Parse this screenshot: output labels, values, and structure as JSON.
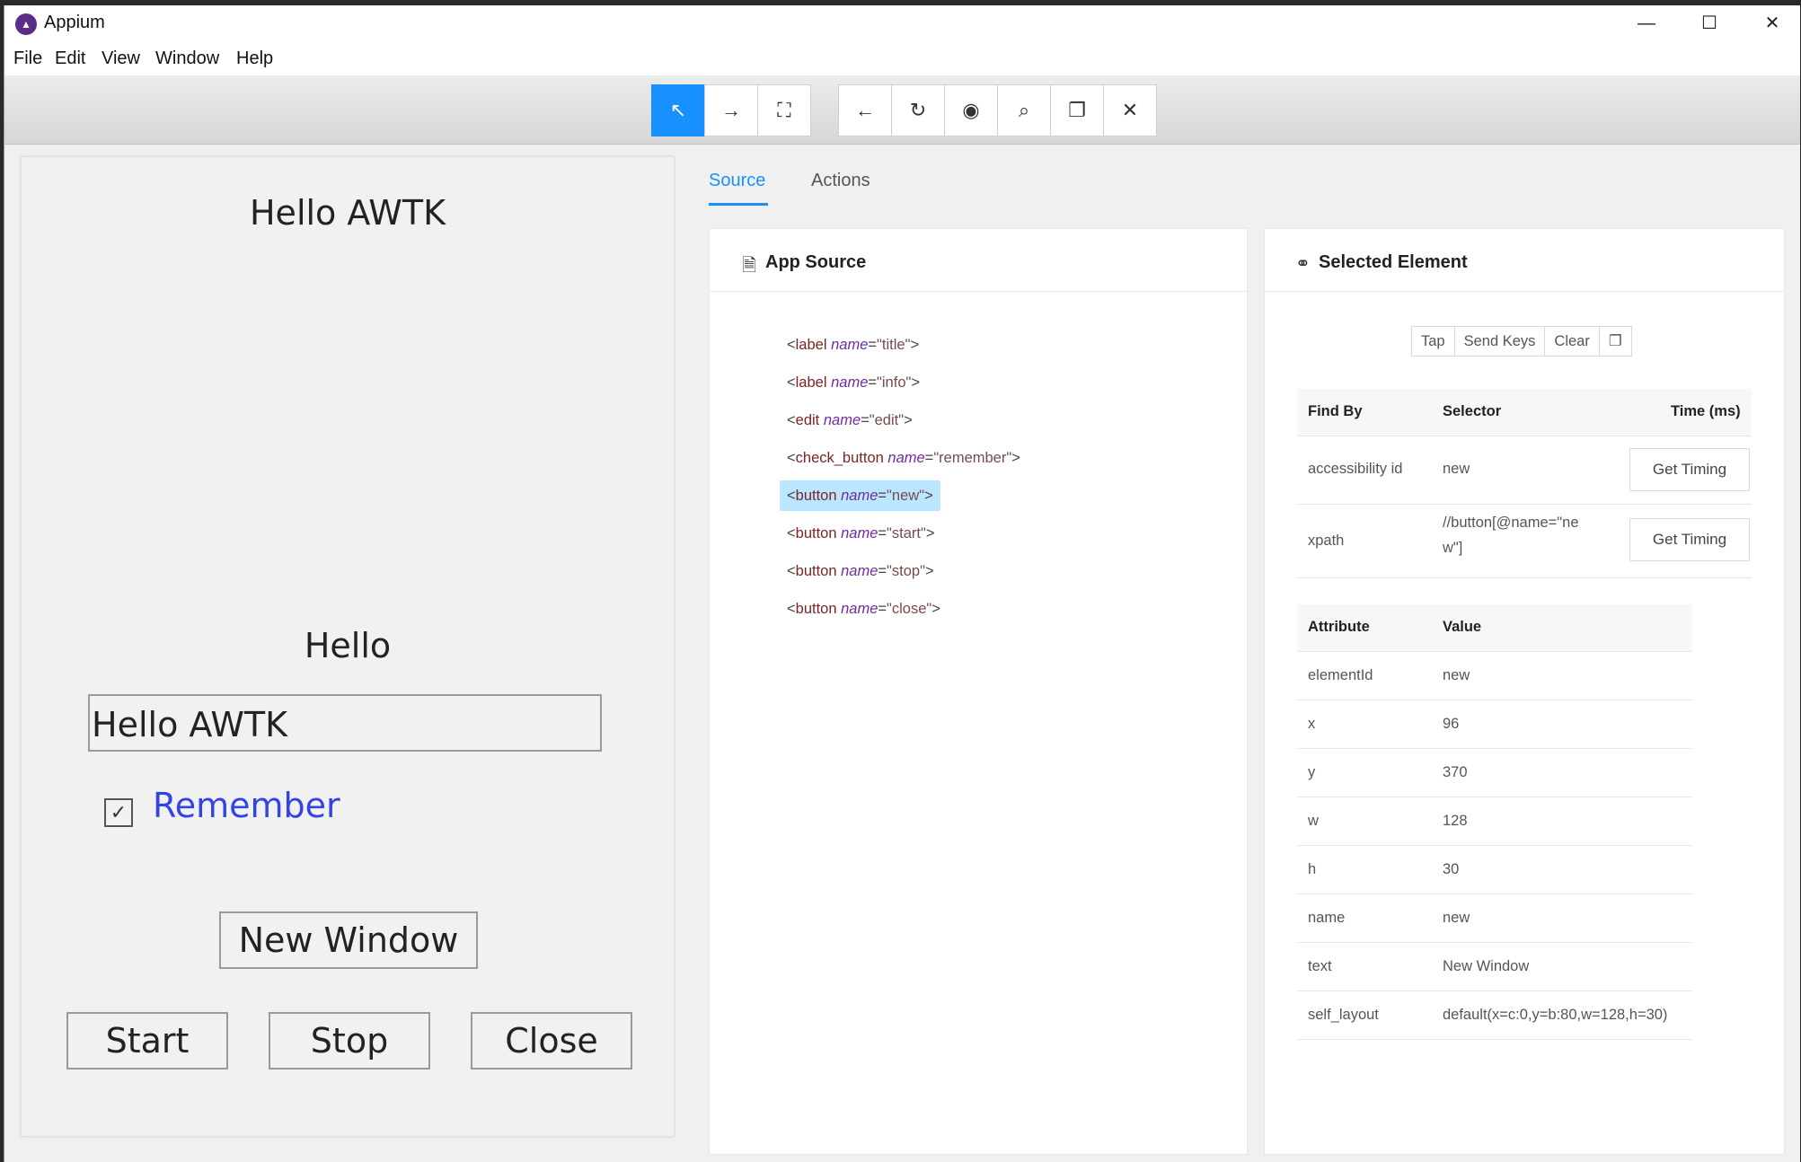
{
  "window": {
    "title": "Appium",
    "logo_icon": "appium-logo-icon",
    "minimize": "—",
    "maximize": "☐",
    "close": "✕"
  },
  "menu": [
    "File",
    "Edit",
    "View",
    "Window",
    "Help"
  ],
  "toolbar": {
    "group1": [
      {
        "icon": "select-elements-icon",
        "glyph": "↖",
        "active": true
      },
      {
        "icon": "swipe-icon",
        "glyph": "→",
        "active": false
      },
      {
        "icon": "tap-coordinates-icon",
        "glyph": "⛶",
        "active": false
      }
    ],
    "group2": [
      {
        "icon": "back-icon",
        "glyph": "←"
      },
      {
        "icon": "refresh-icon",
        "glyph": "↻"
      },
      {
        "icon": "eye-icon",
        "glyph": "◉"
      },
      {
        "icon": "search-icon",
        "glyph": "⌕"
      },
      {
        "icon": "copy-icon",
        "glyph": "❐"
      },
      {
        "icon": "quit-session-icon",
        "glyph": "✕"
      }
    ]
  },
  "device": {
    "title": "Hello AWTK",
    "info": "Hello",
    "edit_value": "Hello AWTK",
    "check_glyph": "✓",
    "check_label": "Remember",
    "checked": true,
    "buttons": {
      "new": "New Window",
      "start": "Start",
      "stop": "Stop",
      "close": "Close"
    }
  },
  "tabs": {
    "source": "Source",
    "actions": "Actions"
  },
  "source_panel": {
    "title": "App Source",
    "icon": "file-icon",
    "nodes": [
      {
        "tag": "label",
        "attr": "name",
        "value": "\"title\""
      },
      {
        "tag": "label",
        "attr": "name",
        "value": "\"info\""
      },
      {
        "tag": "edit",
        "attr": "name",
        "value": "\"edit\""
      },
      {
        "tag": "check_button",
        "attr": "name",
        "value": "\"remember\""
      },
      {
        "tag": "button",
        "attr": "name",
        "value": "\"new\"",
        "selected": true
      },
      {
        "tag": "button",
        "attr": "name",
        "value": "\"start\""
      },
      {
        "tag": "button",
        "attr": "name",
        "value": "\"stop\""
      },
      {
        "tag": "button",
        "attr": "name",
        "value": "\"close\""
      }
    ]
  },
  "selected_panel": {
    "title": "Selected Element",
    "icon": "tag-icon",
    "actions": [
      "Tap",
      "Send Keys",
      "Clear"
    ],
    "copy_glyph": "❐",
    "find_headers": {
      "find_by": "Find By",
      "selector": "Selector",
      "time": "Time (ms)"
    },
    "find_rows": [
      {
        "find_by": "accessibility id",
        "selector": "new",
        "button": "Get Timing"
      },
      {
        "find_by": "xpath",
        "selector_line1": "//button[@name=\"ne",
        "selector_line2": "w\"]",
        "button": "Get Timing"
      }
    ],
    "attr_headers": {
      "attribute": "Attribute",
      "value": "Value"
    },
    "attributes": [
      {
        "name": "elementId",
        "value": "new"
      },
      {
        "name": "x",
        "value": "96"
      },
      {
        "name": "y",
        "value": "370"
      },
      {
        "name": "w",
        "value": "128"
      },
      {
        "name": "h",
        "value": "30"
      },
      {
        "name": "name",
        "value": "new"
      },
      {
        "name": "text",
        "value": "New Window"
      },
      {
        "name": "self_layout",
        "value": "default(x=c:0,y=b:80,w=128,h=30)"
      }
    ]
  },
  "colors": {
    "accent": "#1890ff",
    "selected_node": "#bae7ff",
    "tag": "#7d2424",
    "attr": "#6f2ba0",
    "checkbox_label": "#3344e6"
  }
}
